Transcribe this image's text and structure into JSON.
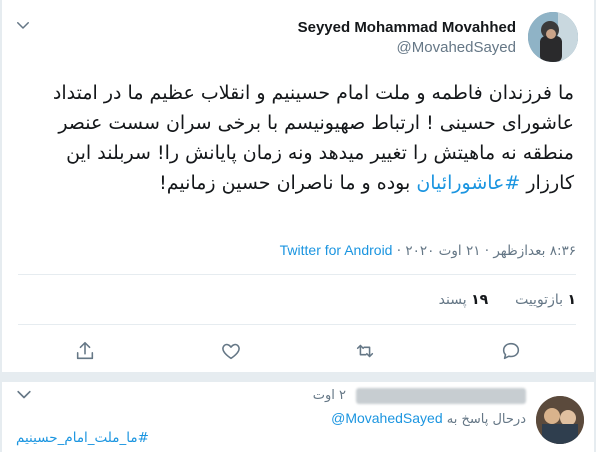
{
  "tweet": {
    "display_name": "Seyyed Mohammad Movahhed",
    "handle": "@MovahedSayed",
    "text_plain": "ما فرزندان فاطمه و ملت امام حسینیم و انقلاب عظیم ما در امتداد عاشورای حسینی ! ارتباط صهیونیسم با برخی سران سست عنصر منطقه نه ماهیتش را تغییر میدهد ونه زمان پایانش را! سربلند این کارزار ",
    "hashtag": "#عاشورائیان",
    "text_after": " بوده و ما ناصران حسین زمانیم!",
    "time": "۸:۳۶ بعدازظهر",
    "date": "۲۱ اوت ۲۰۲۰",
    "separator": "·",
    "client": "Twitter for Android"
  },
  "stats": {
    "retweets_count": "۱",
    "retweets_label": "بازتوییت",
    "likes_count": "۱۹",
    "likes_label": "پسند"
  },
  "actions": {
    "reply_icon": "reply-icon",
    "retweet_icon": "retweet-icon",
    "like_icon": "heart-icon",
    "share_icon": "share-icon"
  },
  "reply": {
    "time": "۲ اوت",
    "replying_prefix": "درحال پاسخ به",
    "mention": "@MovahedSayed",
    "hashtag": "#ما_ملت_امام_حسینیم"
  },
  "colors": {
    "accent": "#1b95e0",
    "secondary_text": "#657786",
    "primary_text": "#14171a",
    "border": "#e6ecf0"
  }
}
